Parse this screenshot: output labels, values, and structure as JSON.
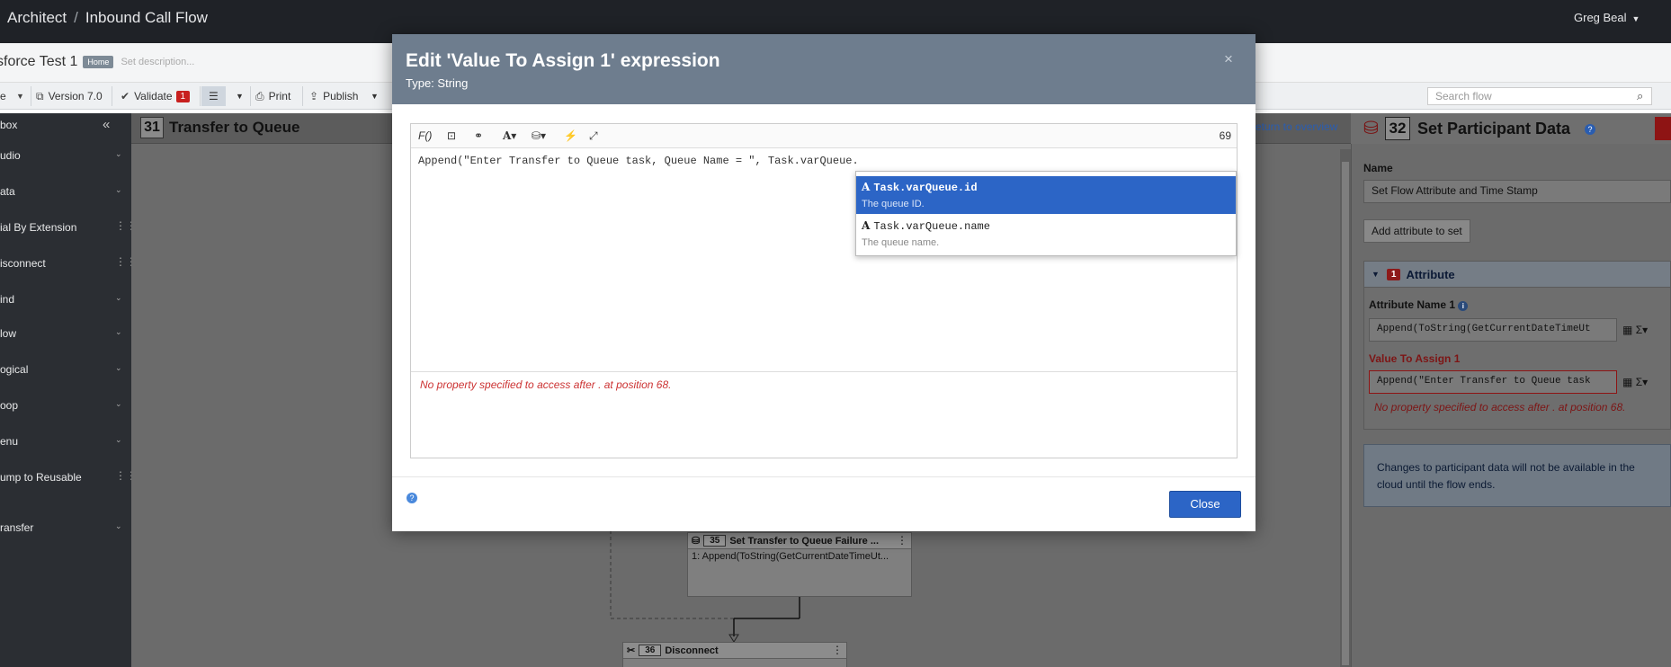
{
  "topbar": {
    "crumb_app": "Architect",
    "crumb_sep": "/",
    "crumb_flow": "Inbound Call Flow",
    "user_name": "Greg Beal"
  },
  "flowhead": {
    "flow_name": "sforce Test 1",
    "home_badge": "Home",
    "description_placeholder": "Set description..."
  },
  "toolbar": {
    "version": "Version 7.0",
    "validate": "Validate",
    "validate_count": "1",
    "print": "Print",
    "publish": "Publish",
    "search_placeholder": "Search flow"
  },
  "toolbox": {
    "header": "box",
    "items": [
      {
        "label": "udio"
      },
      {
        "label": "ata"
      },
      {
        "label": "ial By Extension"
      },
      {
        "label": "isconnect"
      },
      {
        "label": "ind"
      },
      {
        "label": "low"
      },
      {
        "label": "ogical"
      },
      {
        "label": "oop"
      },
      {
        "label": "enu"
      },
      {
        "label": "ump to Reusable"
      },
      {
        "label": "ransfer"
      }
    ]
  },
  "canvas": {
    "task_number": "31",
    "task_title": "Transfer to Queue",
    "back_link": "eturn to overview",
    "nodes": [
      {
        "number": "35",
        "title": "Set Transfer to Queue Failure ...",
        "body": "1: Append(ToString(GetCurrentDateTimeUt..."
      },
      {
        "number": "36",
        "title": "Disconnect",
        "body": ""
      }
    ]
  },
  "right_panel": {
    "number": "32",
    "title": "Set Participant Data",
    "name_label": "Name",
    "name_value": "Set Flow Attribute and Time Stamp",
    "add_attribute_button": "Add attribute to set",
    "attribute_section": "Attribute",
    "attribute_count": "1",
    "attr_name_label": "Attribute Name 1",
    "attr_name_value": "Append(ToString(GetCurrentDateTimeUt",
    "value_label": "Value To Assign 1",
    "value_value": "Append(\"Enter Transfer to Queue task",
    "value_error": "No property specified to access after . at position 68.",
    "notice": "Changes to participant data will not be available in the cloud until the flow ends."
  },
  "modal": {
    "title": "Edit 'Value To Assign 1' expression",
    "subtitle": "Type: String",
    "close_x": "×",
    "toolbar": {
      "fx": "F()",
      "char_count": "69"
    },
    "expression": "Append(\"Enter Transfer to Queue task, Queue Name = \", Task.varQueue.",
    "error": "No property specified to access after . at position 68.",
    "autocomplete": [
      {
        "name": "Task.varQueue.id",
        "desc": "The queue ID.",
        "selected": true
      },
      {
        "name": "Task.varQueue.name",
        "desc": "The queue name.",
        "selected": false
      }
    ],
    "close_button": "Close"
  }
}
